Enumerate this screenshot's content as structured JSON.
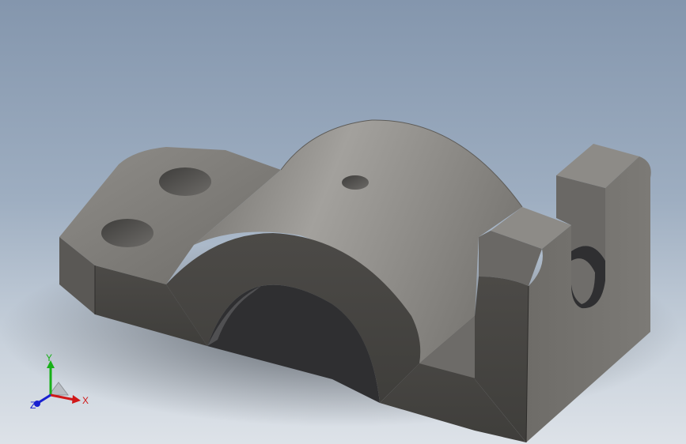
{
  "viewport": {
    "background_top": "#8496ad",
    "background_bottom": "#dde2e8"
  },
  "model": {
    "name_icon": "bracket-part-icon",
    "face_light": "#9c9a96",
    "face_mid": "#7d7b77",
    "face_dark": "#4a4845",
    "face_shadow": "#3c3b39"
  },
  "triad": {
    "x_label": "X",
    "y_label": "Y",
    "z_label": "Z",
    "x_color": "#d01818",
    "y_color": "#18b018",
    "z_color": "#1820d0"
  }
}
